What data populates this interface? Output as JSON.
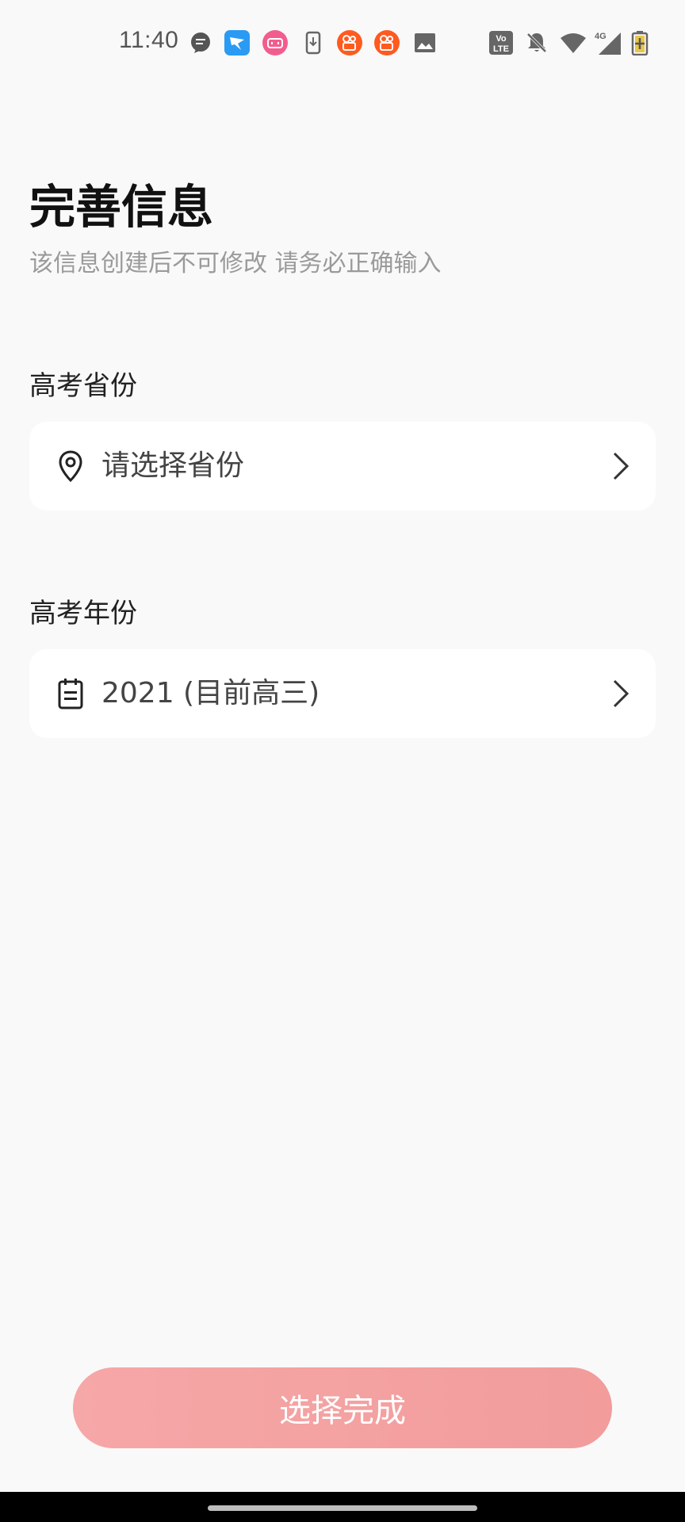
{
  "status_bar": {
    "time": "11:40",
    "network_label": "4G",
    "volte_label_top": "Vo",
    "volte_label_bottom": "LTE"
  },
  "header": {
    "title": "完善信息",
    "subtitle": "该信息创建后不可修改 请务必正确输入"
  },
  "province_section": {
    "label": "高考省份",
    "value": "请选择省份",
    "icon": "location-pin-icon"
  },
  "year_section": {
    "label": "高考年份",
    "value": "2021 (目前高三)",
    "icon": "calendar-icon"
  },
  "submit": {
    "label": "选择完成"
  },
  "colors": {
    "background": "#f9f9f9",
    "card": "#ffffff",
    "button_gradient_start": "#f6a7a7",
    "button_gradient_end": "#f29c9c",
    "subtitle": "#9a9a9a"
  }
}
